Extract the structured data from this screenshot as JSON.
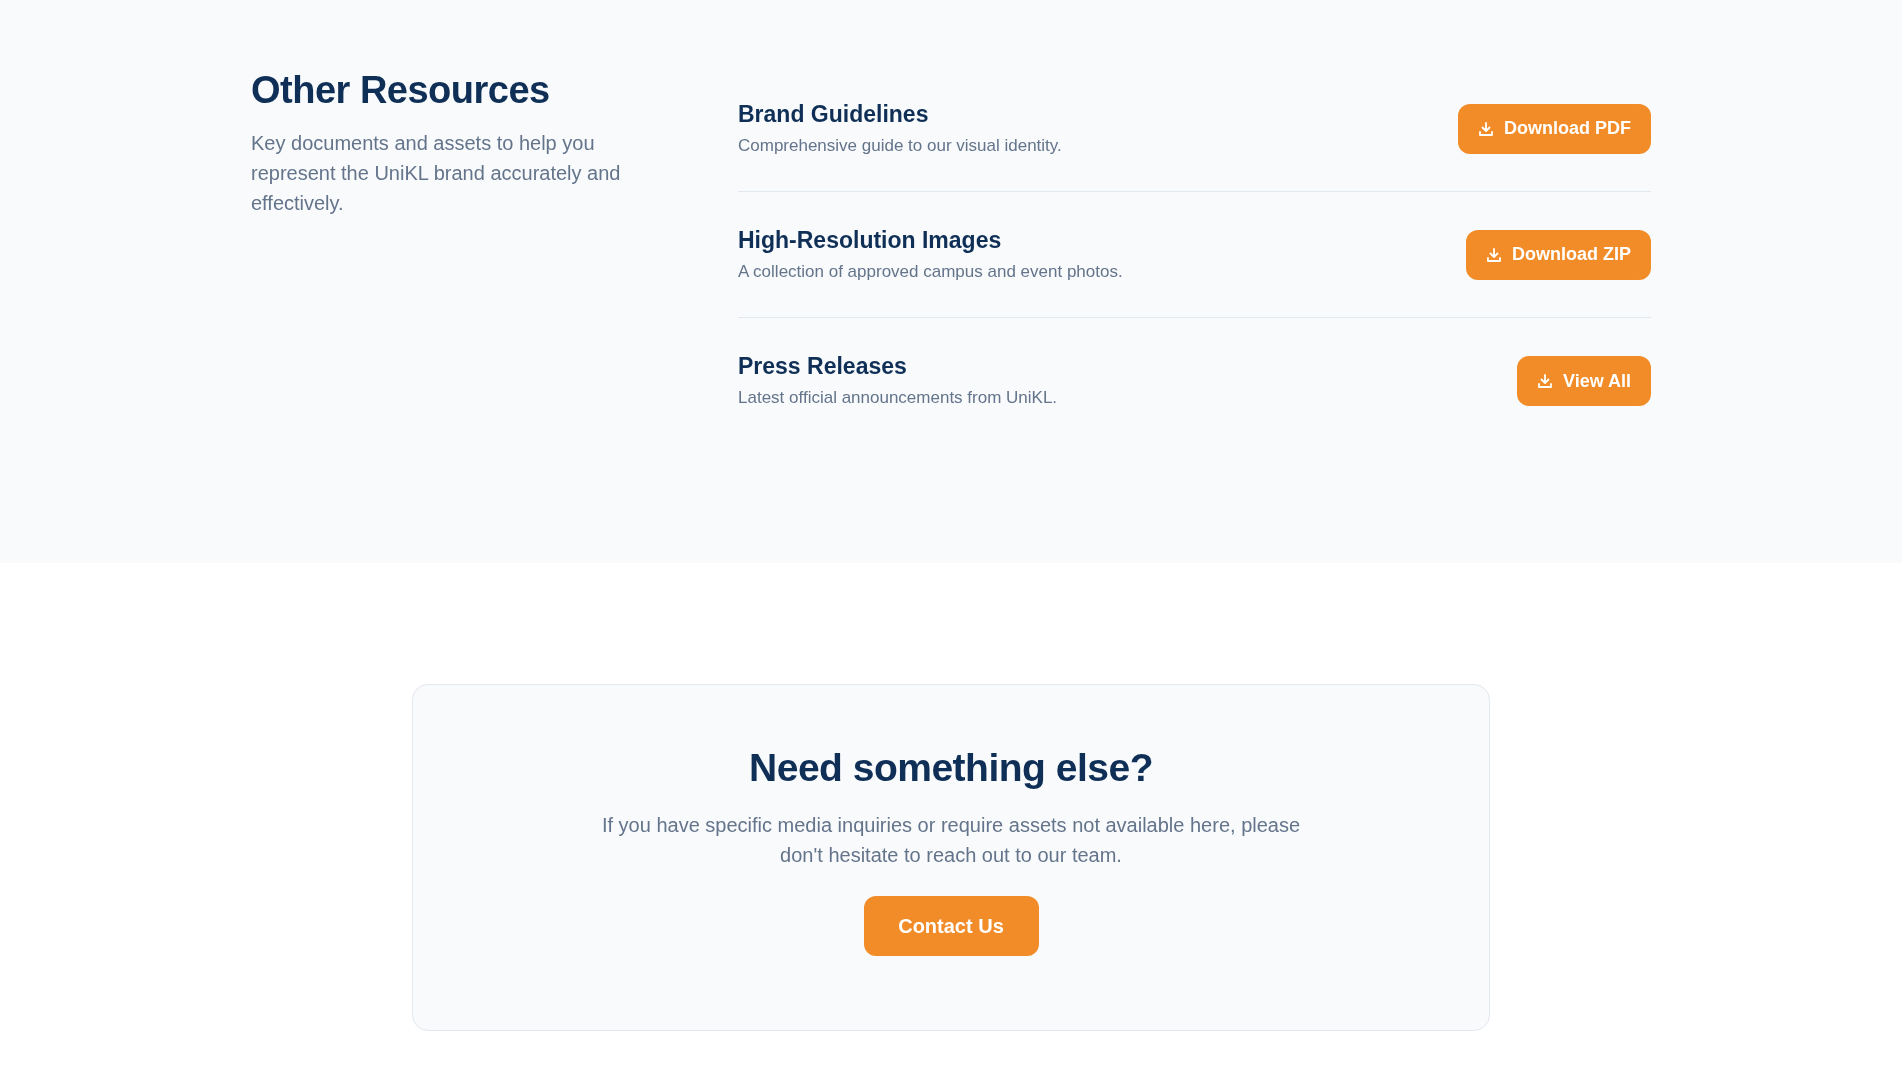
{
  "resources": {
    "title": "Other Resources",
    "description": "Key documents and assets to help you represent the UniKL brand accurately and effectively.",
    "items": [
      {
        "title": "Brand Guidelines",
        "description": "Comprehensive guide to our visual identity.",
        "button": "Download PDF"
      },
      {
        "title": "High-Resolution Images",
        "description": "A collection of approved campus and event photos.",
        "button": "Download ZIP"
      },
      {
        "title": "Press Releases",
        "description": "Latest official announcements from UniKL.",
        "button": "View All"
      }
    ]
  },
  "contact": {
    "title": "Need something else?",
    "text": "If you have specific media inquiries or require assets not available here, please don't hesitate to reach out to our team.",
    "button": "Contact Us"
  }
}
